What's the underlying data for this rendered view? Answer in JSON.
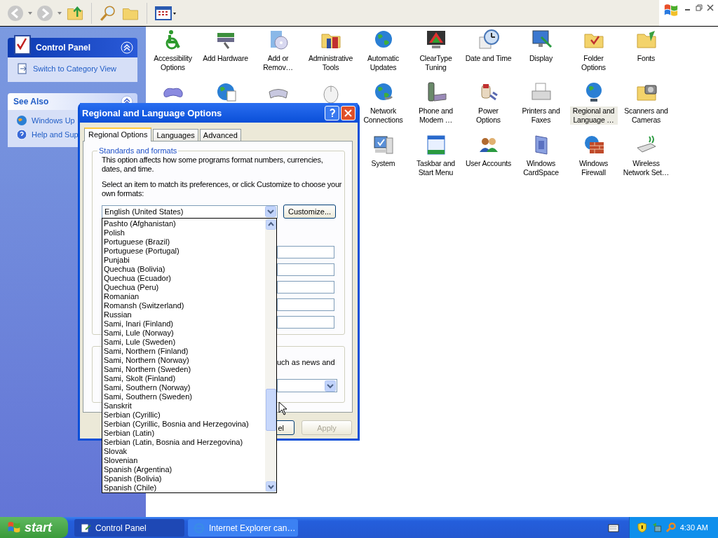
{
  "toolbar": {
    "back_disabled": true,
    "forward_disabled": true
  },
  "sidebar": {
    "panels": [
      {
        "title": "Control Panel",
        "kind": "primary",
        "expanded": true,
        "links": [
          "Switch to Category View"
        ]
      },
      {
        "title": "See Also",
        "kind": "secondary",
        "expanded": true,
        "links": [
          "Windows Up",
          "Help and Sup"
        ]
      }
    ]
  },
  "icons": [
    {
      "kind": "item",
      "label": "Accessibility Options",
      "selected": false
    },
    {
      "kind": "item",
      "label": "Add Hardware",
      "selected": false
    },
    {
      "kind": "item",
      "label": "Add or Remov…",
      "selected": false
    },
    {
      "kind": "item",
      "label": "Administrative Tools",
      "selected": false
    },
    {
      "kind": "item",
      "label": "Automatic Updates",
      "selected": false
    },
    {
      "kind": "item",
      "label": "ClearType Tuning",
      "selected": false
    },
    {
      "kind": "item",
      "label": "Date and Time",
      "selected": false
    },
    {
      "kind": "item",
      "label": "Display",
      "selected": false
    },
    {
      "kind": "item",
      "label": "Folder Options",
      "selected": false
    },
    {
      "kind": "item",
      "label": "Fonts",
      "selected": false
    },
    {
      "kind": "covered"
    },
    {
      "kind": "covered"
    },
    {
      "kind": "covered"
    },
    {
      "kind": "covered"
    },
    {
      "kind": "item",
      "label": "Network Connections",
      "selected": false
    },
    {
      "kind": "item",
      "label": "Phone and Modem …",
      "selected": false
    },
    {
      "kind": "item",
      "label": "Power Options",
      "selected": false
    },
    {
      "kind": "item",
      "label": "Printers and Faxes",
      "selected": false
    },
    {
      "kind": "item",
      "label": "Regional and Language …",
      "selected": true
    },
    {
      "kind": "item",
      "label": "Scanners and Cameras",
      "selected": false
    },
    {
      "kind": "hidden"
    },
    {
      "kind": "hidden"
    },
    {
      "kind": "hidden"
    },
    {
      "kind": "hidden"
    },
    {
      "kind": "item",
      "label": "System",
      "selected": false
    },
    {
      "kind": "item",
      "label": "Taskbar and Start Menu",
      "selected": false
    },
    {
      "kind": "item",
      "label": "User Accounts",
      "selected": false
    },
    {
      "kind": "item",
      "label": "Windows CardSpace",
      "selected": false
    },
    {
      "kind": "item",
      "label": "Windows Firewall",
      "selected": false
    },
    {
      "kind": "item",
      "label": "Wireless Network Set…",
      "selected": false
    }
  ],
  "dialog": {
    "title": "Regional and Language Options",
    "tabs": [
      {
        "label": "Regional Options",
        "selected": true
      },
      {
        "label": "Languages",
        "selected": false
      },
      {
        "label": "Advanced",
        "selected": false
      }
    ],
    "group_title": "Standards and formats",
    "description": "This option affects how some programs format numbers, currencies, dates, and time.",
    "instruction": "Select an item to match its preferences, or click Customize to choose your own formats:",
    "format_value": "English (United States)",
    "customize_button": "Customize...",
    "location_text": "uch as news and",
    "buttons": [
      {
        "label": "el",
        "disabled": false
      },
      {
        "label": "Apply",
        "disabled": true
      }
    ]
  },
  "dropdown": {
    "items": [
      "Pashto (Afghanistan)",
      "Polish",
      "Portuguese (Brazil)",
      "Portuguese (Portugal)",
      "Punjabi",
      "Quechua (Bolivia)",
      "Quechua (Ecuador)",
      "Quechua (Peru)",
      "Romanian",
      "Romansh (Switzerland)",
      "Russian",
      "Sami, Inari (Finland)",
      "Sami, Lule (Norway)",
      "Sami, Lule (Sweden)",
      "Sami, Northern (Finland)",
      "Sami, Northern (Norway)",
      "Sami, Northern (Sweden)",
      "Sami, Skolt (Finland)",
      "Sami, Southern (Norway)",
      "Sami, Southern (Sweden)",
      "Sanskrit",
      "Serbian (Cyrillic)",
      "Serbian (Cyrillic, Bosnia and Herzegovina)",
      "Serbian (Latin)",
      "Serbian (Latin, Bosnia and Herzegovina)",
      "Slovak",
      "Slovenian",
      "Spanish (Argentina)",
      "Spanish (Bolivia)",
      "Spanish (Chile)"
    ]
  },
  "taskbar": {
    "start": "start",
    "tasks": [
      {
        "label": "Control Panel",
        "selected": true
      },
      {
        "label": "Internet Explorer can…",
        "selected": false
      }
    ],
    "clock": "4:30 AM"
  }
}
